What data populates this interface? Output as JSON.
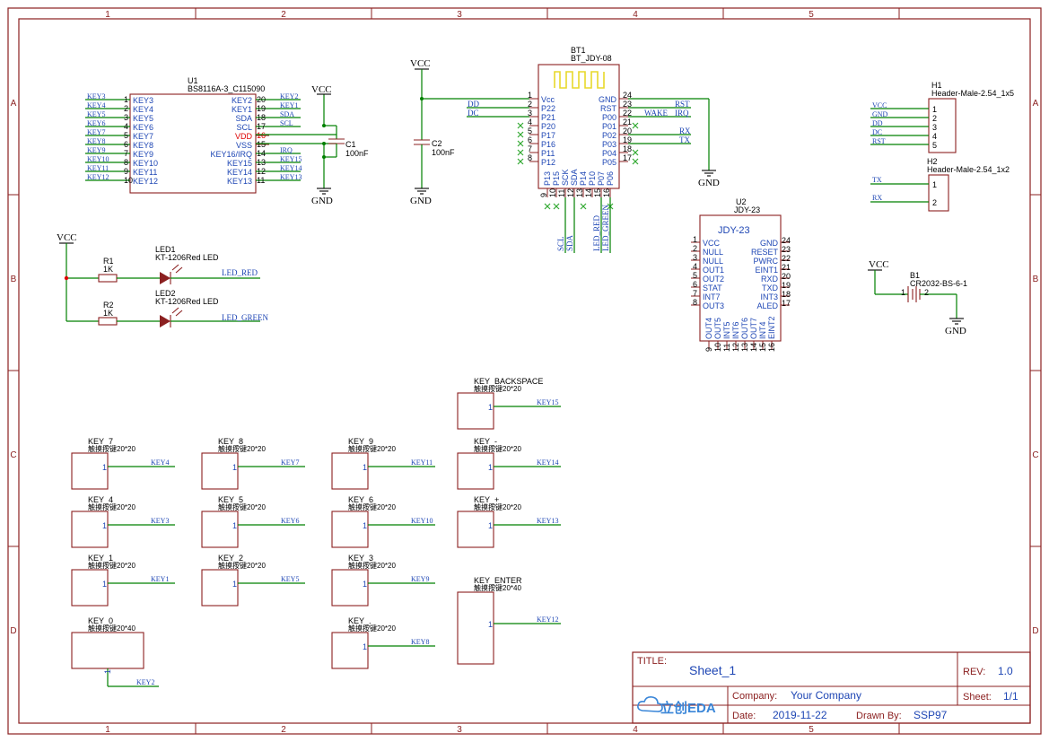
{
  "border": {
    "columns": [
      "1",
      "2",
      "3",
      "4",
      "5"
    ],
    "rows": [
      "A",
      "B",
      "C",
      "D"
    ]
  },
  "titleblock": {
    "title_label": "TITLE:",
    "title": "Sheet_1",
    "rev_label": "REV:",
    "rev": "1.0",
    "company_label": "Company:",
    "company": "Your Company",
    "sheet_label": "Sheet:",
    "sheet": "1/1",
    "date_label": "Date:",
    "date": "2019-11-22",
    "drawn_label": "Drawn By:",
    "drawn": "SSP97",
    "logo_text": "立创EDA"
  },
  "u1": {
    "designator": "U1",
    "part": "BS8116A-3_C115090",
    "left_pins": [
      {
        "num": "1",
        "name": "KEY3",
        "net": "KEY3"
      },
      {
        "num": "2",
        "name": "KEY4",
        "net": "KEY4"
      },
      {
        "num": "3",
        "name": "KEY5",
        "net": "KEY5"
      },
      {
        "num": "4",
        "name": "KEY6",
        "net": "KEY6"
      },
      {
        "num": "5",
        "name": "KEY7",
        "net": "KEY7"
      },
      {
        "num": "6",
        "name": "KEY8",
        "net": "KEY8"
      },
      {
        "num": "7",
        "name": "KEY9",
        "net": "KEY9"
      },
      {
        "num": "8",
        "name": "KEY10",
        "net": "KEY10"
      },
      {
        "num": "9",
        "name": "KEY11",
        "net": "KEY11"
      },
      {
        "num": "10",
        "name": "KEY12",
        "net": "KEY12"
      }
    ],
    "right_pins": [
      {
        "num": "20",
        "name": "KEY2",
        "net": "KEY2"
      },
      {
        "num": "19",
        "name": "KEY1",
        "net": "KEY1"
      },
      {
        "num": "18",
        "name": "SDA",
        "net": "SDA"
      },
      {
        "num": "17",
        "name": "SCL",
        "net": "SCL"
      },
      {
        "num": "16",
        "name": "VDD",
        "net": ""
      },
      {
        "num": "15",
        "name": "VSS",
        "net": ""
      },
      {
        "num": "14",
        "name": "KEY16/IRQ",
        "net": "IRQ"
      },
      {
        "num": "13",
        "name": "KEY15",
        "net": "KEY15"
      },
      {
        "num": "12",
        "name": "KEY14",
        "net": "KEY14"
      },
      {
        "num": "11",
        "name": "KEY13",
        "net": "KEY13"
      }
    ]
  },
  "c1": {
    "designator": "C1",
    "value": "100nF"
  },
  "c2": {
    "designator": "C2",
    "value": "100nF"
  },
  "power": {
    "vcc": "VCC",
    "gnd": "GND"
  },
  "bt1": {
    "designator": "BT1",
    "part": "BT_JDY-08",
    "left_pins": [
      {
        "num": "1",
        "name": "Vcc",
        "net": ""
      },
      {
        "num": "2",
        "name": "P22",
        "net": "DD"
      },
      {
        "num": "3",
        "name": "P21",
        "net": "DC"
      },
      {
        "num": "4",
        "name": "P20",
        "net": ""
      },
      {
        "num": "5",
        "name": "P17",
        "net": ""
      },
      {
        "num": "6",
        "name": "P16",
        "net": ""
      },
      {
        "num": "7",
        "name": "P11",
        "net": ""
      },
      {
        "num": "8",
        "name": "P12",
        "net": ""
      }
    ],
    "right_pins": [
      {
        "num": "24",
        "name": "GND",
        "net": ""
      },
      {
        "num": "23",
        "name": "RST",
        "net": "RST"
      },
      {
        "num": "22",
        "name": "P00",
        "net": "WAKE"
      },
      {
        "num": "21",
        "name": "P01",
        "net": ""
      },
      {
        "num": "20",
        "name": "P02",
        "net": "RX"
      },
      {
        "num": "19",
        "name": "P03",
        "net": "TX"
      },
      {
        "num": "18",
        "name": "P04",
        "net": ""
      },
      {
        "num": "17",
        "name": "P05",
        "net": ""
      }
    ],
    "bottom_pins": [
      {
        "num": "9",
        "name": "P13",
        "net": ""
      },
      {
        "num": "10",
        "name": "P15",
        "net": ""
      },
      {
        "num": "11",
        "name": "SCK",
        "net": "SCL"
      },
      {
        "num": "12",
        "name": "SDA",
        "net": "SDA"
      },
      {
        "num": "13",
        "name": "P14",
        "net": ""
      },
      {
        "num": "14",
        "name": "P10",
        "net": "LED_RED"
      },
      {
        "num": "15",
        "name": "P07",
        "net": "LED_GREEN"
      },
      {
        "num": "16",
        "name": "P06",
        "net": ""
      }
    ],
    "irq_label": "IRQ"
  },
  "u2": {
    "designator": "U2",
    "part": "JDY-23",
    "title": "JDY-23",
    "left_pins": [
      {
        "num": "1",
        "name": "VCC"
      },
      {
        "num": "2",
        "name": "NULL"
      },
      {
        "num": "3",
        "name": "NULL"
      },
      {
        "num": "4",
        "name": "OUT1"
      },
      {
        "num": "5",
        "name": "OUT2"
      },
      {
        "num": "6",
        "name": "STAT"
      },
      {
        "num": "7",
        "name": "INT7"
      },
      {
        "num": "8",
        "name": "OUT3"
      }
    ],
    "right_pins": [
      {
        "num": "24",
        "name": "GND"
      },
      {
        "num": "23",
        "name": "RESET"
      },
      {
        "num": "22",
        "name": "PWRC"
      },
      {
        "num": "21",
        "name": "EINT1"
      },
      {
        "num": "20",
        "name": "RXD"
      },
      {
        "num": "19",
        "name": "TXD"
      },
      {
        "num": "18",
        "name": "INT3"
      },
      {
        "num": "17",
        "name": "ALED"
      }
    ],
    "bottom_pins": [
      {
        "num": "9",
        "name": "OUT4"
      },
      {
        "num": "10",
        "name": "OUT5"
      },
      {
        "num": "11",
        "name": "INT5"
      },
      {
        "num": "12",
        "name": "INT6"
      },
      {
        "num": "13",
        "name": "OUT6"
      },
      {
        "num": "14",
        "name": "OUT7"
      },
      {
        "num": "15",
        "name": "INT4"
      },
      {
        "num": "16",
        "name": "EINT2"
      }
    ]
  },
  "h1": {
    "designator": "H1",
    "part": "Header-Male-2.54_1x5",
    "pins": [
      {
        "num": "1",
        "net": "VCC"
      },
      {
        "num": "2",
        "net": "GND"
      },
      {
        "num": "3",
        "net": "DD"
      },
      {
        "num": "4",
        "net": "DC"
      },
      {
        "num": "5",
        "net": "RST"
      }
    ]
  },
  "h2": {
    "designator": "H2",
    "part": "Header-Male-2.54_1x2",
    "pins": [
      {
        "num": "1",
        "net": "TX"
      },
      {
        "num": "2",
        "net": "RX"
      }
    ]
  },
  "b1": {
    "designator": "B1",
    "part": "CR2032-BS-6-1",
    "pin1": "1",
    "pin2": "2"
  },
  "r1": {
    "designator": "R1",
    "value": "1K"
  },
  "r2": {
    "designator": "R2",
    "value": "1K"
  },
  "led1": {
    "designator": "LED1",
    "part": "KT-1206Red LED",
    "net": "LED_RED"
  },
  "led2": {
    "designator": "LED2",
    "part": "KT-1206Red LED",
    "net": "LED_GREEN"
  },
  "keys": [
    {
      "name": "KEY_BACKSPACE",
      "part": "触摸按键20*20",
      "pin": "1",
      "net": "KEY15"
    },
    {
      "name": "KEY_7",
      "part": "触摸按键20*20",
      "pin": "1",
      "net": "KEY4"
    },
    {
      "name": "KEY_8",
      "part": "触摸按键20*20",
      "pin": "1",
      "net": "KEY7"
    },
    {
      "name": "KEY_9",
      "part": "触摸按键20*20",
      "pin": "1",
      "net": "KEY11"
    },
    {
      "name": "KEY_-",
      "part": "触摸按键20*20",
      "pin": "1",
      "net": "KEY14"
    },
    {
      "name": "KEY_4",
      "part": "触摸按键20*20",
      "pin": "1",
      "net": "KEY3"
    },
    {
      "name": "KEY_5",
      "part": "触摸按键20*20",
      "pin": "1",
      "net": "KEY6"
    },
    {
      "name": "KEY_6",
      "part": "触摸按键20*20",
      "pin": "1",
      "net": "KEY10"
    },
    {
      "name": "KEY_+",
      "part": "触摸按键20*20",
      "pin": "1",
      "net": "KEY13"
    },
    {
      "name": "KEY_1",
      "part": "触摸按键20*20",
      "pin": "1",
      "net": "KEY1"
    },
    {
      "name": "KEY_2",
      "part": "触摸按键20*20",
      "pin": "1",
      "net": "KEY5"
    },
    {
      "name": "KEY_3",
      "part": "触摸按键20*20",
      "pin": "1",
      "net": "KEY9"
    },
    {
      "name": "KEY_ENTER",
      "part": "触摸按键20*40",
      "pin": "1",
      "net": "KEY12"
    },
    {
      "name": "KEY_0",
      "part": "触摸按键20*40",
      "pin": "1",
      "net": "KEY2"
    },
    {
      "name": "KEY_.",
      "part": "触摸按键20*20",
      "pin": "1",
      "net": "KEY8"
    }
  ]
}
